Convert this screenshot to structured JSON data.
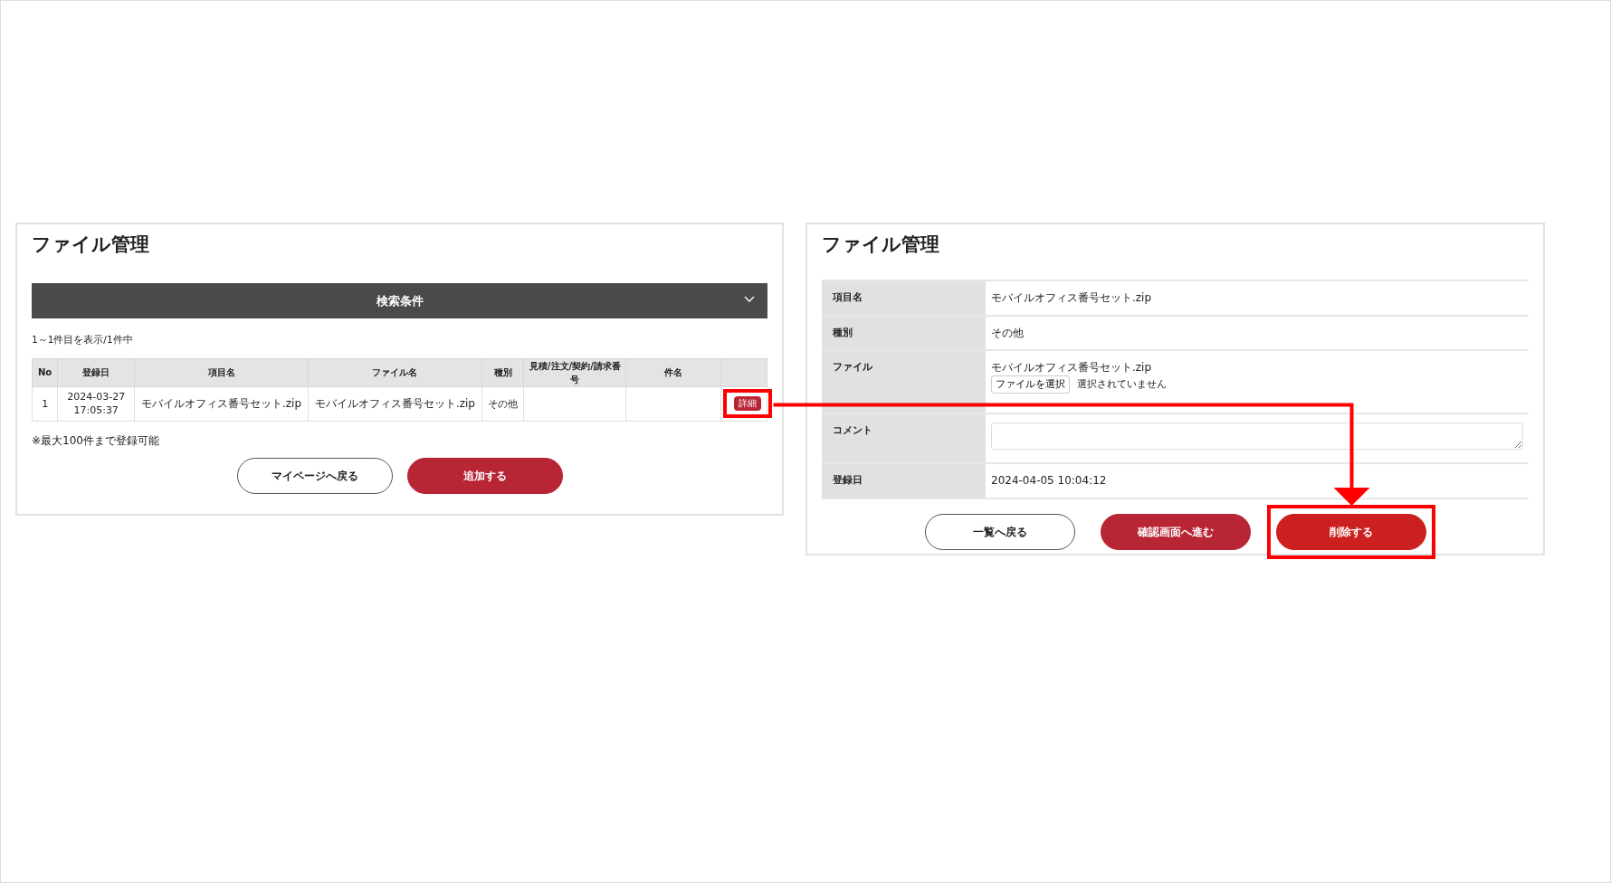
{
  "left_panel": {
    "title": "ファイル管理",
    "search_bar": {
      "label": "検索条件",
      "expanded": false
    },
    "result_count": "1～1件目を表示/1件中",
    "table": {
      "columns": [
        "No",
        "登録日",
        "項目名",
        "ファイル名",
        "種別",
        "見積/注文/契約/請求番号",
        "件名"
      ],
      "rows": [
        {
          "no": "1",
          "date": "2024-03-27",
          "time": "17:05:37",
          "item": "モバイルオフィス番号セット.zip",
          "file": "モバイルオフィス番号セット.zip",
          "type": "その他",
          "detail": {
            "label": "詳細",
            "highlighted": true
          }
        }
      ]
    },
    "note": "※最大100件まで登録可能",
    "buttons": [
      {
        "label": "マイページへ戻る",
        "kind": "outline"
      },
      {
        "label": "追加する",
        "kind": "primary"
      }
    ]
  },
  "right_panel": {
    "title": "ファイル管理",
    "fields": [
      {
        "label": "項目名",
        "kind": "text",
        "value": "モバイルオフィス番号セット.zip"
      },
      {
        "label": "種別",
        "kind": "text",
        "value": "その他"
      },
      {
        "label": "ファイル",
        "kind": "file",
        "value": "モバイルオフィス番号セット.zip",
        "file_button": "ファイルを選択",
        "file_status": "選択されていません"
      },
      {
        "label": "コメント",
        "kind": "textarea"
      },
      {
        "label": "登録日",
        "kind": "text",
        "value": "2024-04-05 10:04:12"
      }
    ],
    "buttons": [
      {
        "label": "一覧へ戻る",
        "kind": "outline",
        "highlighted": false
      },
      {
        "label": "確認画面へ進む",
        "kind": "primary",
        "highlighted": false
      },
      {
        "label": "削除する",
        "kind": "danger",
        "highlighted": true
      }
    ]
  }
}
